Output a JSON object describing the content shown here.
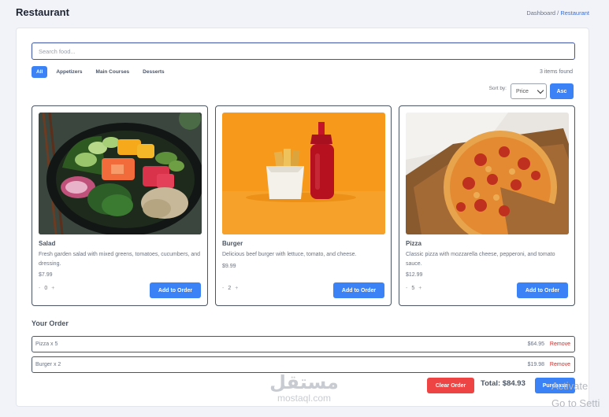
{
  "header": {
    "title": "Restaurant",
    "breadcrumb": {
      "home": "Dashboard",
      "separator": "/",
      "current": "Restaurant"
    }
  },
  "search": {
    "placeholder": "Search food...",
    "value": ""
  },
  "filters": [
    {
      "label": "All",
      "active": true
    },
    {
      "label": "Appetizers",
      "active": false
    },
    {
      "label": "Main Courses",
      "active": false
    },
    {
      "label": "Desserts",
      "active": false
    }
  ],
  "results": {
    "count_text": "3 items found"
  },
  "sort": {
    "label": "Sort by:",
    "selected": "Price",
    "direction_label": "Asc"
  },
  "products": [
    {
      "name": "Salad",
      "description": "Fresh garden salad with mixed greens, tomatoes, cucumbers, and dressing.",
      "price": "$7.99",
      "quantity": "0",
      "minus": "-",
      "plus": "+",
      "button": "Add to Order",
      "image": "salad-bowl"
    },
    {
      "name": "Burger",
      "description": "Delicious beef burger with lettuce, tomato, and cheese.",
      "price": "$9.99",
      "quantity": "2",
      "minus": "-",
      "plus": "+",
      "button": "Add to Order",
      "image": "fries-and-ketchup"
    },
    {
      "name": "Pizza",
      "description": "Classic pizza with mozzarella cheese, pepperoni, and tomato sauce.",
      "price": "$12.99",
      "quantity": "5",
      "minus": "-",
      "plus": "+",
      "button": "Add to Order",
      "image": "pepperoni-pizza"
    }
  ],
  "order": {
    "title": "Your Order",
    "items": [
      {
        "label": "Pizza  x 5",
        "amount": "$64.95",
        "remove": "Remove"
      },
      {
        "label": "Burger  x 2",
        "amount": "$19.98",
        "remove": "Remove"
      }
    ],
    "clear_label": "Clear Order",
    "total_text": "Total: $84.93",
    "purchase_label": "Purchase"
  },
  "watermark": {
    "arabic": "مستقل",
    "latin": "mostaql.com"
  },
  "os_overlay": {
    "line1": "Activate",
    "line2": "Go to Setti"
  },
  "colors": {
    "primary": "#3b82f6",
    "danger": "#ef4444",
    "accent_border": "#3d53a8"
  }
}
